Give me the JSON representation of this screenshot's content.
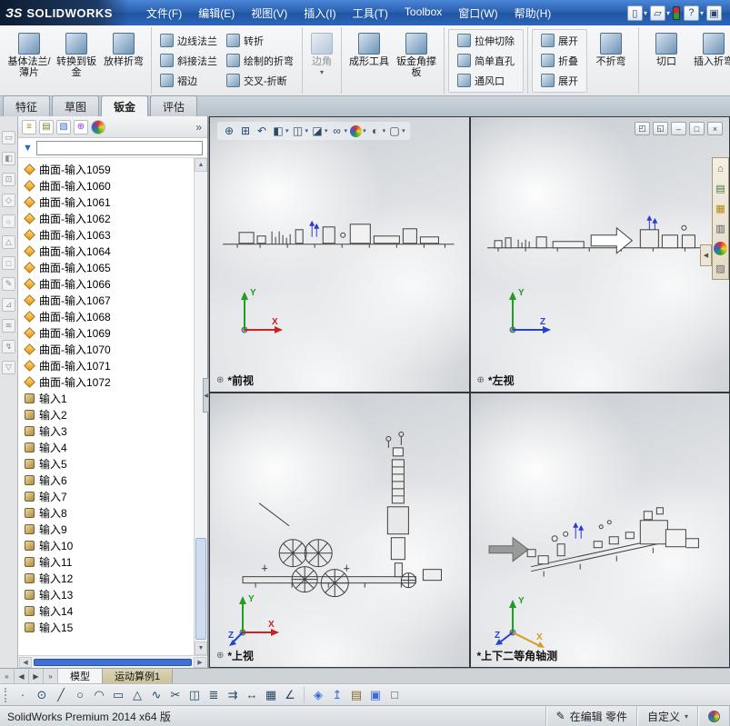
{
  "titlebar": {
    "logo_mark": "ЗS",
    "logo": "SOLIDWORKS",
    "menus": [
      "文件(F)",
      "编辑(E)",
      "视图(V)",
      "插入(I)",
      "工具(T)",
      "Toolbox",
      "窗口(W)",
      "帮助(H)"
    ],
    "icons": [
      {
        "name": "new-document-icon",
        "glyph": "▯",
        "caret": "▾"
      },
      {
        "name": "open-icon",
        "glyph": "▱",
        "caret": "▾"
      },
      {
        "name": "rebuild-indicator-icon",
        "glyph": "",
        "caret": "",
        "style": "background:linear-gradient(#c83232 45%,#2e9e32 55%);width:8px;min-width:8px;height:15px;border:1px solid #234;border-radius:2px"
      },
      {
        "name": "help-icon",
        "glyph": "?",
        "caret": "▾"
      },
      {
        "name": "fullscreen-icon",
        "glyph": "▣",
        "caret": ""
      }
    ]
  },
  "ribbon": {
    "caret": "▾",
    "large_flange": [
      {
        "name": "base-flange-button",
        "label": "基体法兰/薄片"
      },
      {
        "name": "convert-to-sheet-metal-button",
        "label": "转换到钣金"
      },
      {
        "name": "lofted-bend-button",
        "label": "放样折弯"
      }
    ],
    "small_col_a": [
      {
        "name": "edge-flange-button",
        "label": "边线法兰"
      },
      {
        "name": "miter-flange-button",
        "label": "斜接法兰"
      },
      {
        "name": "hem-button",
        "label": "褶边"
      }
    ],
    "small_col_b": [
      {
        "name": "jog-button",
        "label": "转折"
      },
      {
        "name": "sketched-bend-button",
        "label": "绘制的折弯"
      },
      {
        "name": "cross-break-button",
        "label": "交叉-折断"
      }
    ],
    "corner_label": "边角",
    "forming_label": "成形工具",
    "gusset_label": "钣金角撑板",
    "cut_col": [
      {
        "name": "extruded-cut-button",
        "label": "拉伸切除"
      },
      {
        "name": "simple-hole-button",
        "label": "简单直孔"
      },
      {
        "name": "vent-button",
        "label": "通风口"
      }
    ],
    "fold_col": [
      {
        "name": "unfold-button",
        "label": "展开"
      },
      {
        "name": "fold-button",
        "label": "折叠"
      },
      {
        "name": "flatten-button",
        "label": "展开"
      }
    ],
    "no_bends_label": "不折弯",
    "rip_label": "切口",
    "insert_bends_label": "插入折弯"
  },
  "tabs": {
    "features": "特征",
    "sketch": "草图",
    "sheet_metal": "钣金",
    "evaluate": "评估"
  },
  "leftdock": {
    "icons": [
      {
        "glyph": "▭"
      },
      {
        "glyph": "◧"
      },
      {
        "glyph": "⊡"
      },
      {
        "glyph": "◇"
      },
      {
        "glyph": "○"
      },
      {
        "glyph": "△"
      },
      {
        "glyph": "□"
      },
      {
        "glyph": "✎"
      },
      {
        "glyph": "⊿"
      },
      {
        "glyph": "≋"
      },
      {
        "glyph": "↯"
      },
      {
        "glyph": "▽"
      }
    ]
  },
  "panel": {
    "chevron": "»",
    "filter_value": "",
    "funnel_glyph": "▼",
    "up_arrow": "▲",
    "down_arrow": "▼",
    "left_arrow": "◀",
    "right_arrow": "▶",
    "collapse_glyph": "◀",
    "head_icons": [
      {
        "name": "featuremanager-tree-icon",
        "glyph": "≡",
        "style": "color:#b8860b"
      },
      {
        "name": "propertymanager-icon",
        "glyph": "▤",
        "style": "color:#6a8a2a"
      },
      {
        "name": "configurationmanager-icon",
        "glyph": "▧",
        "style": "color:#3a6ad8"
      },
      {
        "name": "dimxpertmanager-icon",
        "glyph": "⊕",
        "style": "color:#8a3ad8"
      },
      {
        "name": "displaymanager-icon",
        "glyph": "",
        "style": "background:conic-gradient(#d83030,#e8d830,#30a030,#3060d8,#d83030);border-radius:50%"
      }
    ]
  },
  "tree": {
    "surfaces": [
      "曲面-输入1059",
      "曲面-输入1060",
      "曲面-输入1061",
      "曲面-输入1062",
      "曲面-输入1063",
      "曲面-输入1064",
      "曲面-输入1065",
      "曲面-输入1066",
      "曲面-输入1067",
      "曲面-输入1068",
      "曲面-输入1069",
      "曲面-输入1070",
      "曲面-输入1071",
      "曲面-输入1072"
    ],
    "inputs": [
      "输入1",
      "输入2",
      "输入3",
      "输入4",
      "输入5",
      "输入6",
      "输入7",
      "输入8",
      "输入9",
      "输入10",
      "输入11",
      "输入12",
      "输入13",
      "输入14",
      "输入15"
    ]
  },
  "headsup": {
    "icons": [
      {
        "name": "zoom-fit-icon",
        "glyph": "⊕",
        "caret": ""
      },
      {
        "name": "zoom-area-icon",
        "glyph": "⊞",
        "caret": ""
      },
      {
        "name": "previous-view-icon",
        "glyph": "↶",
        "caret": ""
      },
      {
        "name": "section-view-icon",
        "glyph": "◧",
        "caret": "▾"
      },
      {
        "name": "view-orientation-icon",
        "glyph": "◫",
        "caret": "▾"
      },
      {
        "name": "display-style-icon",
        "glyph": "◪",
        "caret": "▾"
      },
      {
        "name": "hide-show-items-icon",
        "glyph": "∞",
        "caret": "▾"
      },
      {
        "name": "edit-appearance-icon",
        "glyph": "",
        "caret": "▾",
        "style": "background:conic-gradient(#d83030,#e8d830,#30a030,#3060d8,#d83030);border-radius:50%;width:13px;min-width:13px;height:13px;margin:1px"
      },
      {
        "name": "apply-scene-icon",
        "glyph": "◐",
        "caret": "▾"
      },
      {
        "name": "view-settings-icon",
        "glyph": "▢",
        "caret": "▾"
      }
    ]
  },
  "window_controls": [
    {
      "name": "restore-viewport-icon",
      "glyph": "◰"
    },
    {
      "name": "split-viewport-icon",
      "glyph": "◱"
    },
    {
      "name": "minimize-icon",
      "glyph": "–"
    },
    {
      "name": "maximize-icon",
      "glyph": "□"
    },
    {
      "name": "close-icon",
      "glyph": "×"
    }
  ],
  "taskpane": {
    "collapse_glyph": "◀",
    "icons": [
      {
        "name": "home-icon",
        "glyph": "⌂",
        "style": "color:#7a5a2a"
      },
      {
        "name": "design-library-icon",
        "glyph": "▤",
        "style": "color:#3a7a3a"
      },
      {
        "name": "file-explorer-icon",
        "glyph": "▦",
        "style": "color:#b8860b"
      },
      {
        "name": "view-palette-icon",
        "glyph": "▥",
        "style": "color:#555"
      },
      {
        "name": "appearances-icon",
        "glyph": "",
        "style": "background:conic-gradient(#d83030,#e8d830,#30a030,#3060d8,#d83030);border-radius:50%"
      },
      {
        "name": "custom-properties-icon",
        "glyph": "▨",
        "style": "color:#666"
      }
    ]
  },
  "viewports": {
    "front": {
      "label": "*前视",
      "origin_glyph": "⊕",
      "triad": [
        "Y",
        "X"
      ]
    },
    "left": {
      "label": "*左视",
      "origin_glyph": "⊕",
      "triad": [
        "Y",
        "Z"
      ]
    },
    "top": {
      "label": "*上视",
      "origin_glyph": "⊕",
      "triad": [
        "Y",
        "X",
        "Z"
      ]
    },
    "iso": {
      "label": "*上下二等角轴测",
      "triad": [
        "Y",
        "X",
        "Z"
      ]
    }
  },
  "bottom": {
    "nav": [
      "«",
      "◀",
      "▶",
      "»"
    ],
    "model_tab": "模型",
    "motion_tab": "运动算例1"
  },
  "sketchbar": {
    "tools": [
      {
        "name": "point-tool-icon",
        "glyph": "·"
      },
      {
        "name": "circle-tool-icon",
        "glyph": "⊙"
      },
      {
        "name": "line-tool-icon",
        "glyph": "╱"
      },
      {
        "name": "ellipse-tool-icon",
        "glyph": "○"
      },
      {
        "name": "arc-tool-icon",
        "glyph": "◠"
      },
      {
        "name": "rectangle-tool-icon",
        "glyph": "▭"
      },
      {
        "name": "polygon-tool-icon",
        "glyph": "△"
      },
      {
        "name": "spline-tool-icon",
        "glyph": "∿"
      },
      {
        "name": "trim-tool-icon",
        "glyph": "✂"
      },
      {
        "name": "mirror-tool-icon",
        "glyph": "◫"
      },
      {
        "name": "offset-tool-icon",
        "glyph": "≣"
      },
      {
        "name": "convert-entities-icon",
        "glyph": "⇉"
      },
      {
        "name": "dimension-tool-icon",
        "glyph": "↔"
      },
      {
        "name": "grid-icon",
        "glyph": "▦"
      },
      {
        "name": "angle-dimension-icon",
        "glyph": "∠"
      }
    ],
    "view_tools": [
      {
        "name": "isometric-cube-icon",
        "glyph": "◈",
        "style": "color:#3a6ad8"
      },
      {
        "name": "normal-to-icon",
        "glyph": "↥",
        "style": "color:#3a6ad8"
      },
      {
        "name": "drawing-sheet-icon",
        "glyph": "▤",
        "style": "color:#8a6a2a"
      },
      {
        "name": "shaded-cube-icon",
        "glyph": "▣",
        "style": "color:#3a6ad8"
      },
      {
        "name": "wireframe-box-icon",
        "glyph": "□",
        "style": "color:#556"
      }
    ]
  },
  "statusbar": {
    "left": "SolidWorks Premium 2014 x64 版",
    "edit_icon": "✎",
    "editing": "在编辑 零件",
    "custom": "自定义",
    "caret": "▾"
  }
}
